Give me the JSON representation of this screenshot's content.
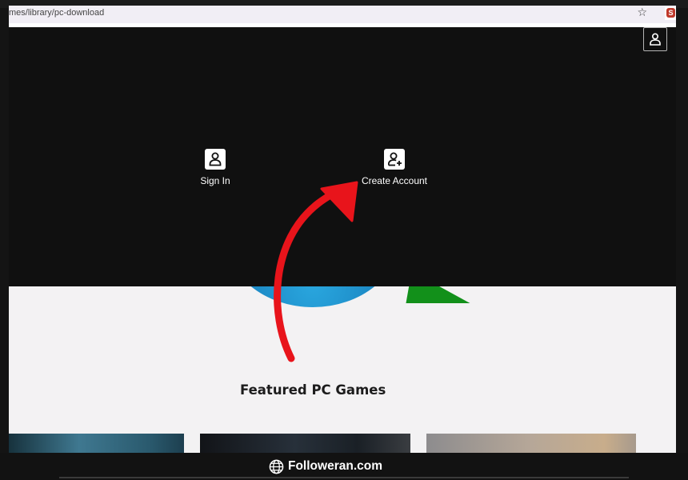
{
  "browser": {
    "url": "mes/library/pc-download",
    "bookmark_icon": "star-icon",
    "extension_icon": "extension-icon",
    "extension_label": "S"
  },
  "menu": {
    "account_icon": "user-icon",
    "options": [
      {
        "label": "Sign In",
        "icon": "user-icon"
      },
      {
        "label": "Create Account",
        "icon": "user-plus-icon"
      }
    ]
  },
  "page": {
    "section_title": "Featured PC Games"
  },
  "annotation": {
    "arrow_color": "#e8141b"
  },
  "watermark": {
    "text": "Followeran.com",
    "icon": "globe-icon"
  },
  "colors": {
    "menu_bg": "#101010",
    "page_bg": "#f3f2f3",
    "arrow": "#e8141b"
  }
}
